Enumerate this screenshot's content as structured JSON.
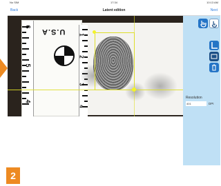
{
  "status": {
    "left": "No SIM",
    "time": "17:34",
    "right": "10:13 AM"
  },
  "nav": {
    "back": "Back",
    "title": "Latent edition",
    "next": "Next"
  },
  "card": {
    "brand": "U.S.A",
    "ruler_numbers": [
      "6",
      "5",
      "4"
    ],
    "ruler2_numbers": [
      "1",
      "2",
      "3",
      "4"
    ]
  },
  "side": {
    "resolution_label": "Resolution",
    "resolution_value": "401",
    "dpi_label": "DPI"
  },
  "step": {
    "number": "2"
  },
  "colors": {
    "accent": "#ed8a22",
    "selection": "#dede28",
    "panel": "#bfe0f5",
    "button": "#2474c6"
  }
}
